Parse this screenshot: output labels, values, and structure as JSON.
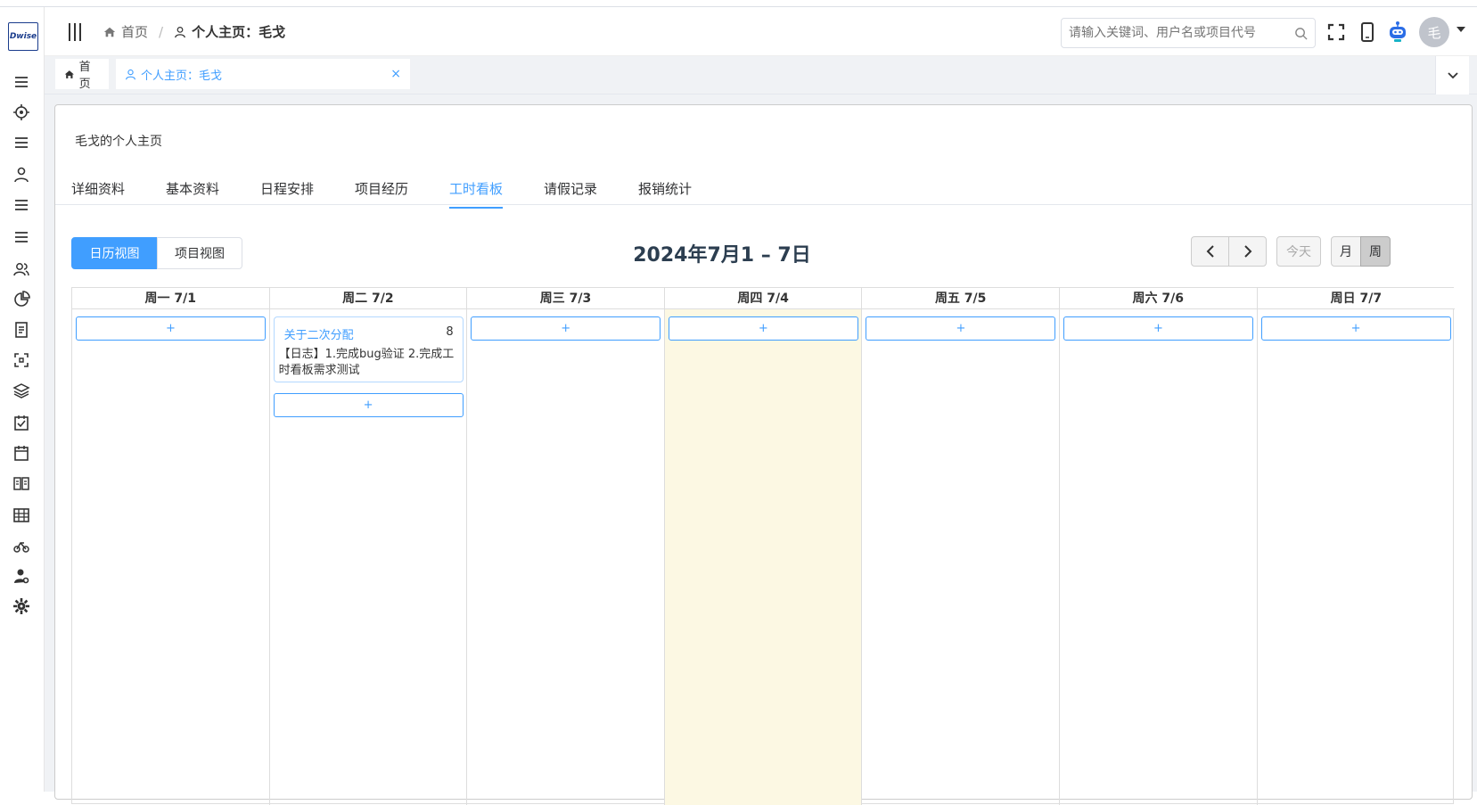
{
  "app": {
    "logo_text": "Dwise"
  },
  "header": {
    "breadcrumb_home": "首页",
    "breadcrumb_sep": "/",
    "breadcrumb_current": "个人主页：毛戈",
    "search_placeholder": "请输入关键词、用户名或项目代号",
    "avatar_text": "毛"
  },
  "sidebar": {
    "icons": [
      "menu-icon",
      "target-icon",
      "list-icon",
      "user-icon",
      "list-icon",
      "list-icon",
      "users-icon",
      "pie-chart-icon",
      "document-icon",
      "scan-icon",
      "layers-icon",
      "checklist-icon",
      "calendar-icon",
      "book-icon",
      "table-icon",
      "bike-icon",
      "user-settings-icon",
      "gear-icon"
    ]
  },
  "tagsview": {
    "home_label": "首页",
    "current_label": "个人主页：毛戈",
    "close_symbol": "×"
  },
  "page": {
    "title": "毛戈的个人主页",
    "tabs": [
      "详细资料",
      "基本资料",
      "日程安排",
      "项目经历",
      "工时看板",
      "请假记录",
      "报销统计"
    ],
    "active_tab": "工时看板"
  },
  "calendar": {
    "view_buttons": [
      "日历视图",
      "项目视图"
    ],
    "active_view": "日历视图",
    "title": "2024年7月1 – 7日",
    "prev_symbol": "‹",
    "next_symbol": "›",
    "today_label": "今天",
    "month_label": "月",
    "week_label": "周",
    "add_symbol": "+",
    "days": [
      "周一 7/1",
      "周二 7/2",
      "周三 7/3",
      "周四 7/4",
      "周五 7/5",
      "周六 7/6",
      "周日 7/7"
    ],
    "today_index": 3,
    "entry": {
      "project": "关于二次分配",
      "hours": "8",
      "log": "【日志】1.完成bug验证 2.完成工时看板需求测试"
    }
  },
  "colors": {
    "accent": "#409eff",
    "today_bg": "#fcf8e3"
  }
}
